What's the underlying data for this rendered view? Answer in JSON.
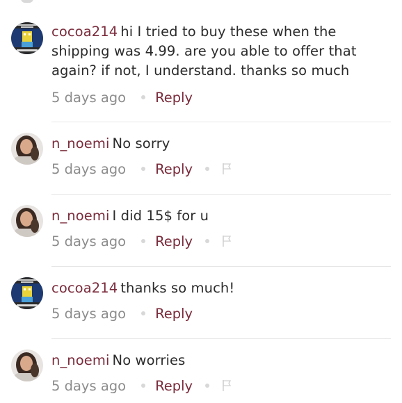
{
  "comments": [
    {
      "username": "cocoa214",
      "text": "hi I tried to buy these when the shipping was 4.99. are you able to offer that again? if not, I understand. thanks so much",
      "time": "5 days ago",
      "reply_label": "Reply",
      "avatar": "cartoon-meme-avatar",
      "has_flag": false
    },
    {
      "username": "n_noemi",
      "text": "No sorry",
      "time": "5 days ago",
      "reply_label": "Reply",
      "avatar": "profile-photo-avatar",
      "has_flag": true
    },
    {
      "username": "n_noemi",
      "text": "I did 15$ for u",
      "time": "5 days ago",
      "reply_label": "Reply",
      "avatar": "profile-photo-avatar",
      "has_flag": true
    },
    {
      "username": "cocoa214",
      "text": "thanks so much!",
      "time": "5 days ago",
      "reply_label": "Reply",
      "avatar": "cartoon-meme-avatar",
      "has_flag": false
    },
    {
      "username": "n_noemi",
      "text": "No worries",
      "time": "5 days ago",
      "reply_label": "Reply",
      "avatar": "profile-photo-avatar",
      "has_flag": true
    }
  ],
  "colors": {
    "username": "#7a2b3b",
    "reply": "#7a2b3b",
    "text": "#2b2b2b",
    "time": "#8c8c8c",
    "divider": "#e6e6e6"
  }
}
